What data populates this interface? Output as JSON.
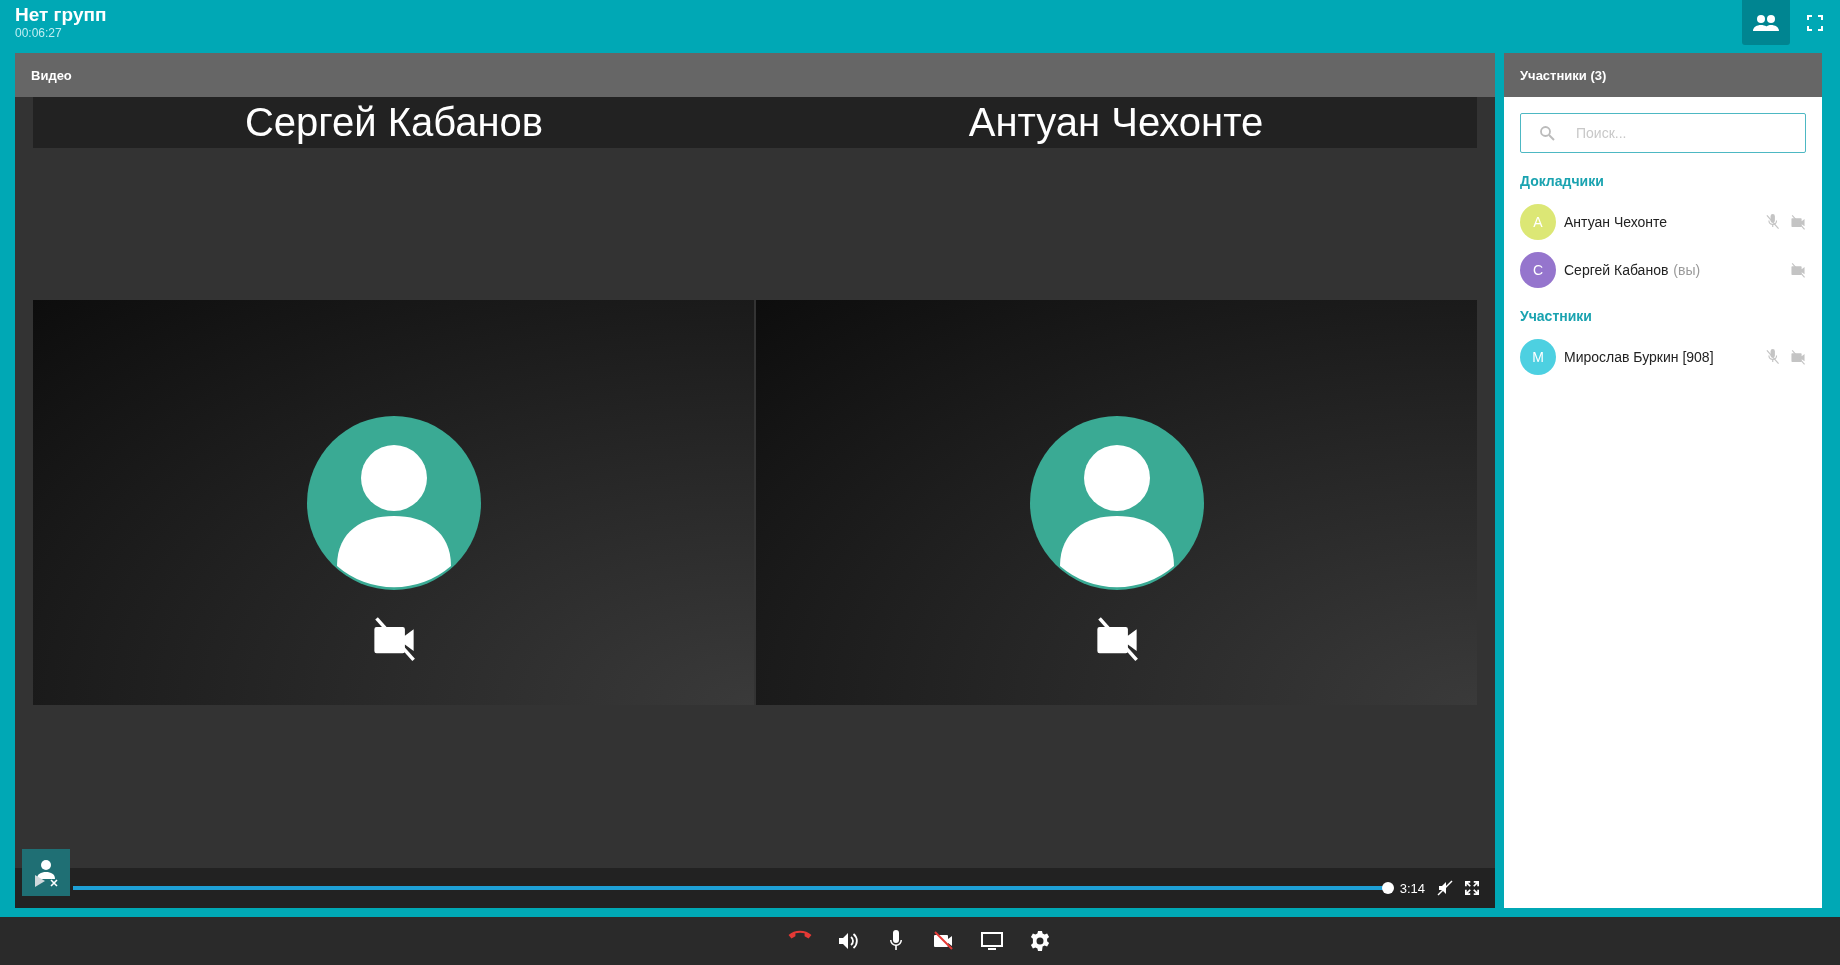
{
  "header": {
    "title": "Нет групп",
    "timer": "00:06:27",
    "participants_button_active": true
  },
  "video": {
    "title": "Видео",
    "tiles": [
      {
        "name": "Сергей Кабанов",
        "camera_off": true
      },
      {
        "name": "Антуан Чехонте",
        "camera_off": true
      }
    ],
    "player": {
      "level": 1,
      "time": "3:14"
    }
  },
  "participants": {
    "title": "Участники (3)",
    "search": {
      "placeholder": "Поиск..."
    },
    "groups": [
      {
        "title": "Докладчики",
        "members": [
          {
            "initial": "А",
            "color": "#dce775",
            "name": "Антуан Чехонте",
            "mic_off": true,
            "camera_off": true
          },
          {
            "initial": "С",
            "color": "#9575cd",
            "name": "Сергей Кабанов",
            "suffix": "(вы)",
            "mic_off": false,
            "camera_off": true
          }
        ]
      },
      {
        "title": "Участники",
        "members": [
          {
            "initial": "М",
            "color": "#4dd0e1",
            "name": "Мирослав Буркин [908]",
            "mic_off": true,
            "camera_off": true
          }
        ]
      }
    ]
  },
  "toolbar": [
    {
      "kind": "hangup"
    },
    {
      "kind": "speaker"
    },
    {
      "kind": "mic"
    },
    {
      "kind": "camera_off"
    },
    {
      "kind": "screen"
    },
    {
      "kind": "settings"
    }
  ]
}
